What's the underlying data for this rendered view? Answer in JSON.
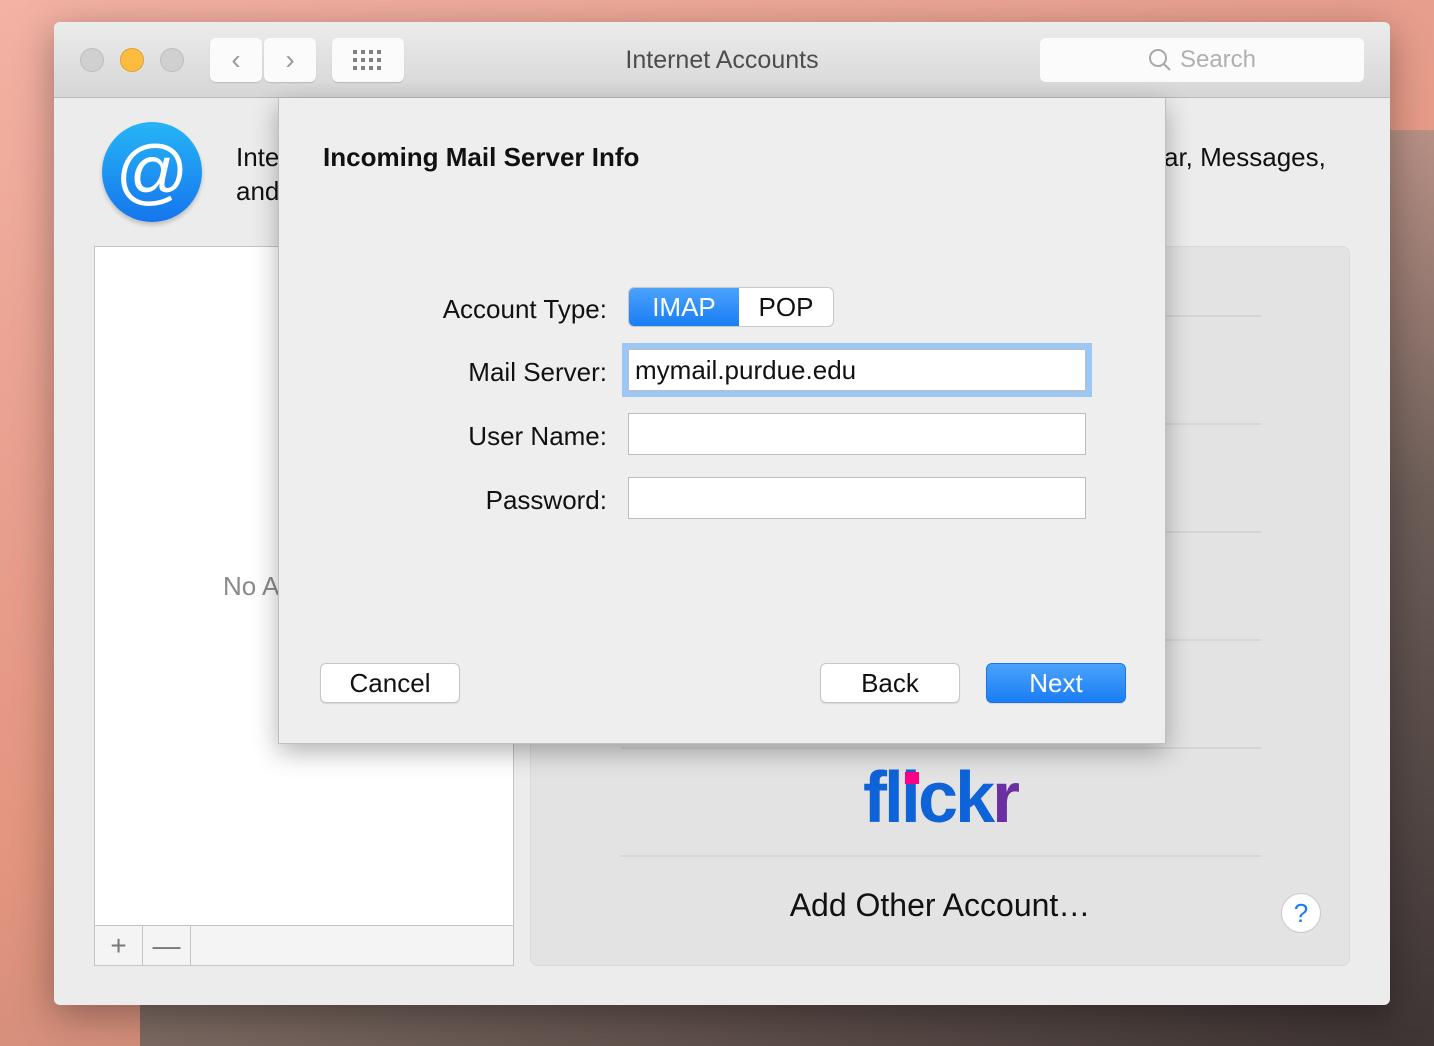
{
  "window": {
    "title": "Internet Accounts",
    "search_placeholder": "Search"
  },
  "header": {
    "line1_left": "Inte",
    "line2_left": "and",
    "line1_right": "ar, Messages,"
  },
  "accounts_list": {
    "empty_text": "No A",
    "add_label": "+",
    "remove_label": "—"
  },
  "providers": {
    "flickr_logo": "flickr",
    "add_other": "Add Other Account…",
    "help": "?"
  },
  "dialog": {
    "title": "Incoming Mail Server Info",
    "account_type_label": "Account Type:",
    "account_type_options": [
      "IMAP",
      "POP"
    ],
    "account_type_selected": "IMAP",
    "mail_server_label": "Mail Server:",
    "mail_server_value": "mymail.purdue.edu",
    "user_name_label": "User Name:",
    "user_name_value": "",
    "password_label": "Password:",
    "password_value": "",
    "cancel": "Cancel",
    "back": "Back",
    "next": "Next"
  },
  "colors": {
    "accent": "#1a7df5",
    "minimize": "#fdbc40",
    "flickr_blue": "#0f63d8",
    "flickr_pink": "#ff0084",
    "flickr_purple": "#6a2fa0"
  }
}
